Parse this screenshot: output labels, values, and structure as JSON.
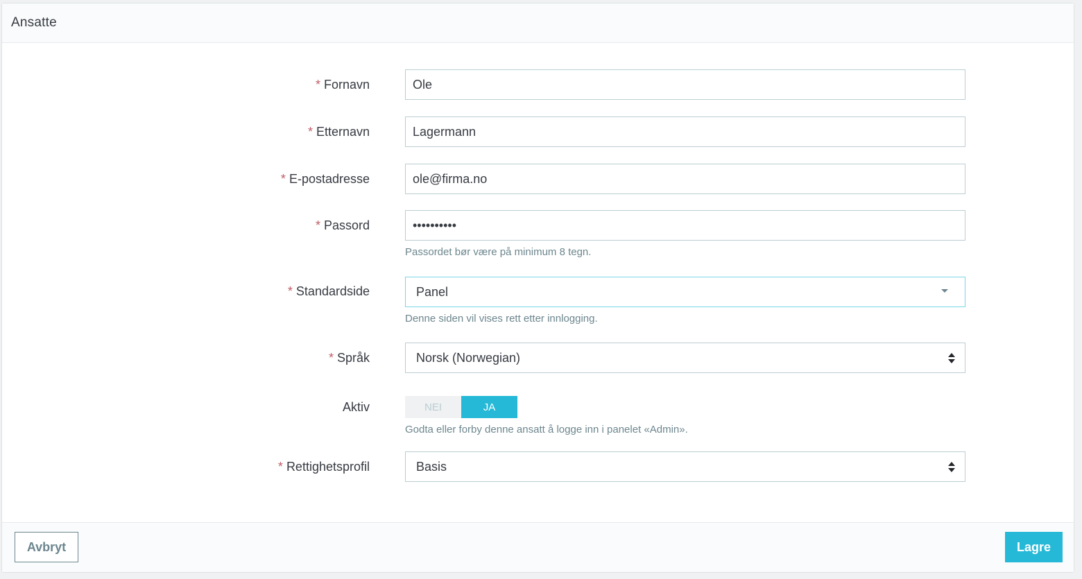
{
  "header": {
    "title": "Ansatte"
  },
  "form": {
    "required_marker": "*",
    "firstname": {
      "label": "Fornavn",
      "value": "Ole"
    },
    "lastname": {
      "label": "Etternavn",
      "value": "Lagermann"
    },
    "email": {
      "label": "E-postadresse",
      "value": "ole@firma.no"
    },
    "password": {
      "label": "Passord",
      "value": "••••••••••",
      "help": "Passordet bør være på minimum 8 tegn."
    },
    "default_page": {
      "label": "Standardside",
      "selected": "Panel",
      "help": "Denne siden vil vises rett etter innlogging."
    },
    "language": {
      "label": "Språk",
      "selected": "Norsk (Norwegian)"
    },
    "active": {
      "label": "Aktiv",
      "off_label": "NEI",
      "on_label": "JA",
      "state": "on",
      "help": "Godta eller forby denne ansatt å logge inn i panelet «Admin»."
    },
    "profile": {
      "label": "Rettighetsprofil",
      "selected": "Basis"
    }
  },
  "footer": {
    "cancel_label": "Avbryt",
    "save_label": "Lagre"
  },
  "colors": {
    "accent": "#25b9d7",
    "required": "#c05c67",
    "help_text": "#6c868e"
  }
}
